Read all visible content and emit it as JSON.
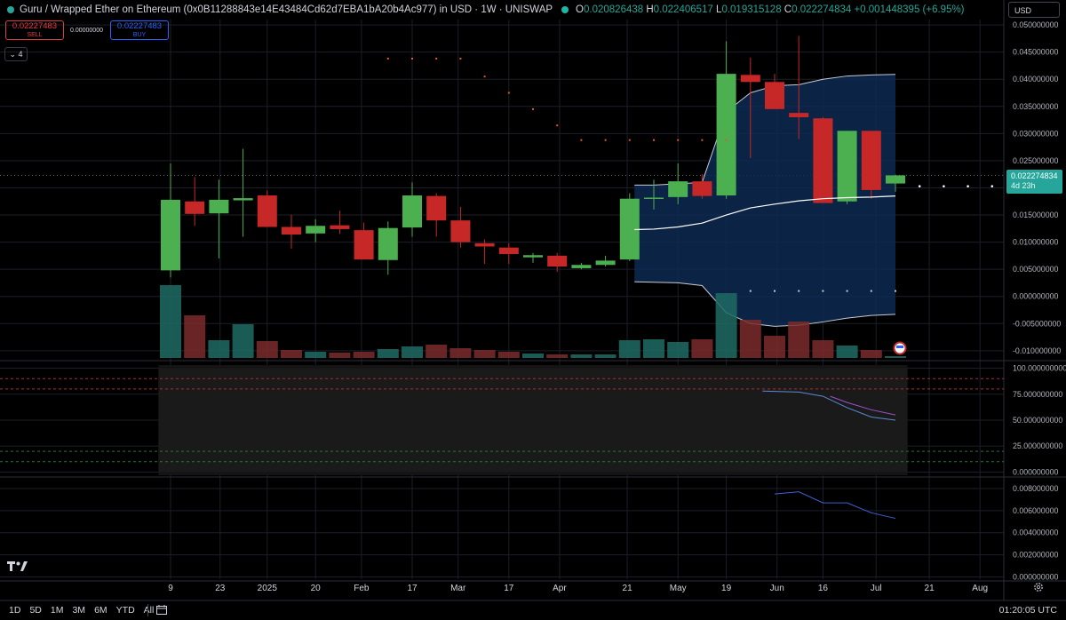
{
  "header": {
    "symbol_text": "Guru / Wrapped Ether on Ethereum (0x0B11288843e14E43484Cd62d7EBA1bA20b4Ac977) in USD · 1W · UNISWAP",
    "open_label": "O",
    "open_value": "0.020826438",
    "high_label": "H",
    "high_value": "0.022406517",
    "low_label": "L",
    "low_value": "0.019315128",
    "close_label": "C",
    "close_value": "0.022274834",
    "change_text": "+0.001448395 (+6.95%)"
  },
  "trade": {
    "sell_price": "0.02227483",
    "sell_label": "SELL",
    "spread": "0.00000000",
    "buy_price": "0.02227483",
    "buy_label": "BUY"
  },
  "collapse_count": "4",
  "currency_selector": "USD",
  "price_flag": {
    "value": "0.022274834",
    "countdown": "4d 23h"
  },
  "bottom": {
    "timeframes": [
      "1D",
      "5D",
      "1M",
      "3M",
      "6M",
      "YTD",
      "All"
    ],
    "clock": "01:20:05 UTC"
  },
  "colors": {
    "up": "#26a69a",
    "up_candle": "#4caf50",
    "down_candle": "#c62828",
    "band_fill": "#0d2a52",
    "rsi_line": "#5b8bd6",
    "rsi_ma": "#a052c9",
    "bottom_line": "#3d62d6",
    "sar_dots": "#e05a2a"
  },
  "chart_data": [
    {
      "type": "candlestick",
      "title": "Guru / Wrapped Ether on Ethereum (0x0B11288843e14E43484Cd62d7EBA1bA20b4Ac977) in USD · 1W · UNISWAP",
      "x_tick_labels": [
        "9",
        "23",
        "2025",
        "20",
        "Feb",
        "17",
        "Mar",
        "17",
        "Apr",
        "21",
        "May",
        "19",
        "Jun",
        "16",
        "Jul",
        "21",
        "Aug"
      ],
      "y_tick_labels": [
        "-0.010000000",
        "-0.005000000",
        "0.000000000",
        "0.005000000",
        "0.010000000",
        "0.015000000",
        "0.020000000",
        "0.025000000",
        "0.030000000",
        "0.035000000",
        "0.040000000",
        "0.045000000",
        "0.050000000"
      ],
      "ylim": [
        -0.0115,
        0.051
      ],
      "candles": [
        {
          "o": 0.0048,
          "h": 0.0245,
          "l": 0.0035,
          "c": 0.0178
        },
        {
          "o": 0.0175,
          "h": 0.022,
          "l": 0.013,
          "c": 0.0152
        },
        {
          "o": 0.0153,
          "h": 0.0215,
          "l": 0.007,
          "c": 0.0178
        },
        {
          "o": 0.0177,
          "h": 0.0272,
          "l": 0.011,
          "c": 0.0181
        },
        {
          "o": 0.0186,
          "h": 0.0195,
          "l": 0.0148,
          "c": 0.0128
        },
        {
          "o": 0.0128,
          "h": 0.015,
          "l": 0.0088,
          "c": 0.0114
        },
        {
          "o": 0.0116,
          "h": 0.0142,
          "l": 0.01,
          "c": 0.013
        },
        {
          "o": 0.0131,
          "h": 0.0158,
          "l": 0.0115,
          "c": 0.0124
        },
        {
          "o": 0.0122,
          "h": 0.0136,
          "l": 0.0085,
          "c": 0.0068
        },
        {
          "o": 0.0067,
          "h": 0.0138,
          "l": 0.004,
          "c": 0.0126
        },
        {
          "o": 0.0127,
          "h": 0.021,
          "l": 0.011,
          "c": 0.0186
        },
        {
          "o": 0.0185,
          "h": 0.019,
          "l": 0.011,
          "c": 0.014
        },
        {
          "o": 0.014,
          "h": 0.0165,
          "l": 0.009,
          "c": 0.01
        },
        {
          "o": 0.0098,
          "h": 0.0105,
          "l": 0.006,
          "c": 0.0092
        },
        {
          "o": 0.009,
          "h": 0.0098,
          "l": 0.006,
          "c": 0.0078
        },
        {
          "o": 0.0072,
          "h": 0.008,
          "l": 0.0062,
          "c": 0.0076
        },
        {
          "o": 0.0075,
          "h": 0.008,
          "l": 0.0045,
          "c": 0.0055
        },
        {
          "o": 0.0052,
          "h": 0.0062,
          "l": 0.005,
          "c": 0.0058
        },
        {
          "o": 0.0058,
          "h": 0.0075,
          "l": 0.0055,
          "c": 0.0066
        },
        {
          "o": 0.0068,
          "h": 0.019,
          "l": 0.0065,
          "c": 0.018
        },
        {
          "o": 0.018,
          "h": 0.0215,
          "l": 0.016,
          "c": 0.0182
        },
        {
          "o": 0.0183,
          "h": 0.0245,
          "l": 0.017,
          "c": 0.0212
        },
        {
          "o": 0.0212,
          "h": 0.0225,
          "l": 0.018,
          "c": 0.0185
        },
        {
          "o": 0.0186,
          "h": 0.047,
          "l": 0.018,
          "c": 0.041
        },
        {
          "o": 0.0408,
          "h": 0.044,
          "l": 0.0255,
          "c": 0.0395
        },
        {
          "o": 0.0395,
          "h": 0.041,
          "l": 0.0345,
          "c": 0.0345
        },
        {
          "o": 0.0338,
          "h": 0.048,
          "l": 0.029,
          "c": 0.033
        },
        {
          "o": 0.0328,
          "h": 0.033,
          "l": 0.0172,
          "c": 0.0172
        },
        {
          "o": 0.0175,
          "h": 0.0305,
          "l": 0.017,
          "c": 0.0305
        },
        {
          "o": 0.0305,
          "h": 0.0305,
          "l": 0.018,
          "c": 0.0196
        },
        {
          "o": 0.0208,
          "h": 0.0224,
          "l": 0.0193,
          "c": 0.0223
        }
      ],
      "volume_relative": [
        0.82,
        0.48,
        0.2,
        0.38,
        0.19,
        0.09,
        0.07,
        0.06,
        0.07,
        0.1,
        0.13,
        0.15,
        0.11,
        0.09,
        0.07,
        0.05,
        0.04,
        0.04,
        0.04,
        0.2,
        0.21,
        0.18,
        0.21,
        0.73,
        0.43,
        0.25,
        0.41,
        0.2,
        0.14,
        0.09,
        0.02
      ],
      "bollinger_upper": [
        {
          "i": 19.2,
          "v": 0.0205
        },
        {
          "i": 20,
          "v": 0.0205
        },
        {
          "i": 22,
          "v": 0.021
        },
        {
          "i": 23,
          "v": 0.034
        },
        {
          "i": 24,
          "v": 0.0375
        },
        {
          "i": 25,
          "v": 0.0388
        },
        {
          "i": 26,
          "v": 0.039
        },
        {
          "i": 27,
          "v": 0.04
        },
        {
          "i": 28,
          "v": 0.0406
        },
        {
          "i": 29,
          "v": 0.0408
        },
        {
          "i": 30,
          "v": 0.0409
        }
      ],
      "bollinger_basis": [
        {
          "i": 19.2,
          "v": 0.0123
        },
        {
          "i": 20,
          "v": 0.0124
        },
        {
          "i": 21,
          "v": 0.0128
        },
        {
          "i": 22,
          "v": 0.0135
        },
        {
          "i": 23,
          "v": 0.015
        },
        {
          "i": 24,
          "v": 0.0163
        },
        {
          "i": 25,
          "v": 0.017
        },
        {
          "i": 26,
          "v": 0.0176
        },
        {
          "i": 27,
          "v": 0.018
        },
        {
          "i": 28,
          "v": 0.0182
        },
        {
          "i": 29,
          "v": 0.0183
        },
        {
          "i": 30,
          "v": 0.0185
        }
      ],
      "bollinger_lower": [
        {
          "i": 19.2,
          "v": 0.0027
        },
        {
          "i": 21,
          "v": 0.0025
        },
        {
          "i": 22,
          "v": 0.002
        },
        {
          "i": 23,
          "v": -0.003
        },
        {
          "i": 24,
          "v": -0.005
        },
        {
          "i": 25,
          "v": -0.0055
        },
        {
          "i": 26,
          "v": -0.0053
        },
        {
          "i": 27,
          "v": -0.0047
        },
        {
          "i": 28,
          "v": -0.004
        },
        {
          "i": 29,
          "v": -0.0035
        },
        {
          "i": 30,
          "v": -0.0033
        }
      ],
      "sar_dots": [
        {
          "i": 9,
          "v": 0.0438
        },
        {
          "i": 10,
          "v": 0.0438
        },
        {
          "i": 11,
          "v": 0.0438
        },
        {
          "i": 12,
          "v": 0.0438
        },
        {
          "i": 13,
          "v": 0.0405
        },
        {
          "i": 14,
          "v": 0.0375
        },
        {
          "i": 15,
          "v": 0.0345
        },
        {
          "i": 16,
          "v": 0.0315
        },
        {
          "i": 17,
          "v": 0.0288
        },
        {
          "i": 18,
          "v": 0.0288
        },
        {
          "i": 19,
          "v": 0.0288
        },
        {
          "i": 20,
          "v": 0.0288
        },
        {
          "i": 21,
          "v": 0.0288
        },
        {
          "i": 22,
          "v": 0.0288
        },
        {
          "i": 23,
          "v": 0.0288
        }
      ],
      "lower_sar_dots": [
        {
          "i": 24,
          "v": 0.001
        },
        {
          "i": 25,
          "v": 0.001
        },
        {
          "i": 26,
          "v": 0.001
        },
        {
          "i": 27,
          "v": 0.001
        },
        {
          "i": 28,
          "v": 0.001
        },
        {
          "i": 29,
          "v": 0.001
        },
        {
          "i": 30,
          "v": 0.001
        }
      ],
      "projection_dots": [
        {
          "i": 31,
          "v": 0.0203
        },
        {
          "i": 32,
          "v": 0.0203
        },
        {
          "i": 33,
          "v": 0.0203
        },
        {
          "i": 34,
          "v": 0.0203
        }
      ]
    },
    {
      "type": "line",
      "y_tick_labels": [
        "0.000000000",
        "25.000000000",
        "50.000000000",
        "75.000000000",
        "100.000000000"
      ],
      "ylim": [
        -3,
        103
      ],
      "levels": [
        90,
        80,
        20,
        10
      ],
      "series": [
        {
          "points": [
            {
              "i": 24.5,
              "v": 78
            },
            {
              "i": 26,
              "v": 77
            },
            {
              "i": 27,
              "v": 73
            },
            {
              "i": 28,
              "v": 62
            },
            {
              "i": 29,
              "v": 53
            },
            {
              "i": 30,
              "v": 50
            }
          ]
        },
        {
          "points": [
            {
              "i": 27.3,
              "v": 73
            },
            {
              "i": 28,
              "v": 67
            },
            {
              "i": 29,
              "v": 60
            },
            {
              "i": 30,
              "v": 55
            }
          ]
        }
      ]
    },
    {
      "type": "line",
      "y_tick_labels": [
        "0.000000000",
        "0.002000000",
        "0.004000000",
        "0.006000000",
        "0.008000000"
      ],
      "ylim": [
        -0.0002,
        0.0088
      ],
      "series": [
        {
          "points": [
            {
              "i": 25,
              "v": 0.0075
            },
            {
              "i": 26,
              "v": 0.0077
            },
            {
              "i": 27,
              "v": 0.0067
            },
            {
              "i": 28,
              "v": 0.0067
            },
            {
              "i": 29,
              "v": 0.0058
            },
            {
              "i": 30,
              "v": 0.0053
            }
          ]
        }
      ]
    }
  ]
}
